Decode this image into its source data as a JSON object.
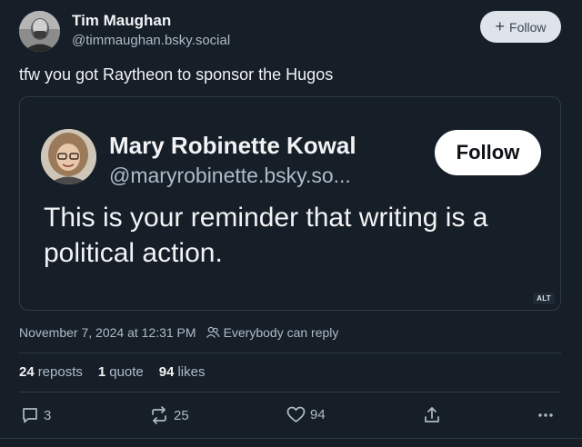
{
  "post": {
    "author": {
      "name": "Tim Maughan",
      "handle": "@timmaughan.bsky.social",
      "avatar_icon": "user-avatar-photo"
    },
    "follow_label": "Follow",
    "text": "tfw you got Raytheon to sponsor the Hugos",
    "embed": {
      "author_name": "Mary Robinette Kowal",
      "handle": "@maryrobinette.bsky.so...",
      "follow_label": "Follow",
      "text": "This is your reminder that writing is a political action.",
      "alt_badge": "ALT"
    },
    "timestamp": "November 7, 2024 at 12:31 PM",
    "reply_setting": "Everybody can reply",
    "stats": {
      "reposts_count": "24",
      "reposts_label": "reposts",
      "quotes_count": "1",
      "quotes_label": "quote",
      "likes_count": "94",
      "likes_label": "likes"
    },
    "actions": {
      "replies": "3",
      "reposts": "25",
      "likes": "94"
    }
  },
  "colors": {
    "background": "#161e27",
    "text_primary": "#f1f3f5",
    "text_secondary": "#aebbc9",
    "border": "#2e3a48"
  }
}
